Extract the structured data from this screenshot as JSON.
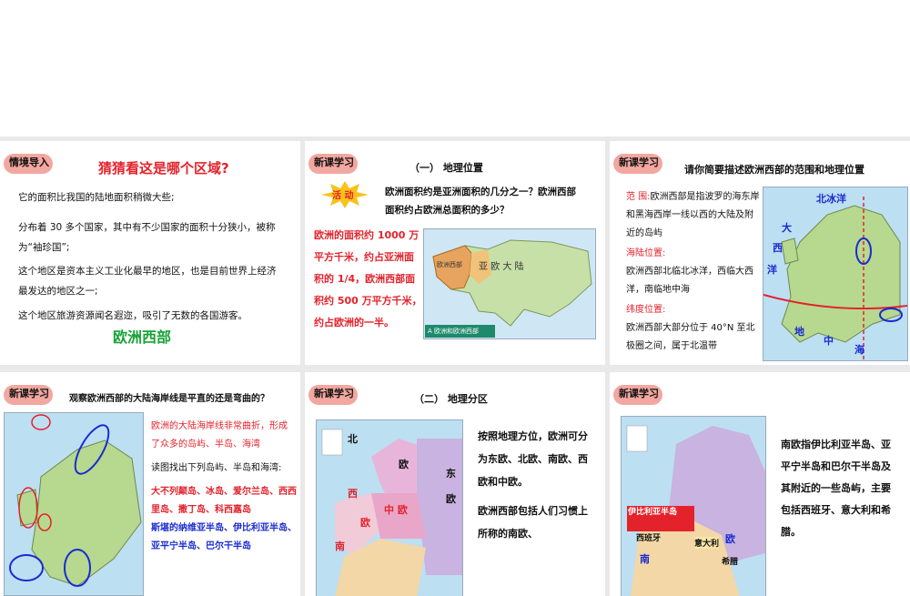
{
  "s1": {
    "tag": "情境导入",
    "title": "猜猜看这是哪个区域?",
    "p1": "它的面积比我国的陆地面积稍微大些;",
    "p2": "分布着 30 多个国家，其中有不少国家的面积十分狭小，被称为“袖珍国”;",
    "p3": "这个地区是资本主义工业化最早的地区，也是目前世界上经济最发达的地区之一;",
    "p4": "这个地区旅游资源闻名遐迩，吸引了无数的各国游客。",
    "answer": "欧洲西部"
  },
  "s2": {
    "tag": "新课学习",
    "heading": "（一） 地理位置",
    "activity": "活 动",
    "question": "欧洲面积约是亚洲面积的几分之一？欧洲西部面积约占欧洲总面积的多少？",
    "answer": "欧洲的面积约 1000 万平方千米，约占亚洲面积的 1/4，欧洲西部面积约 500 万平方千米，约占欧洲的一半。",
    "map_title": "亚 欧 大 陆",
    "map_west": "欧洲西部",
    "map_caption": "A 欧洲和欧洲西部"
  },
  "s3": {
    "tag": "新课学习",
    "heading": "请你简要描述欧洲西部的范围和地理位置",
    "range_label": "范 围:",
    "range_text": "欧洲西部是指波罗的海东岸和黑海西岸一线以西的大陆及附近的岛屿",
    "sea_label": "海陆位置:",
    "sea_text": "欧洲西部北临北冰洋，西临大西洋，南临地中海",
    "lat_label": "纬度位置:",
    "lat_text": "欧洲西部大部分位于 40°N 至北极圈之间，属于北温带",
    "map_labels": [
      "北冰洋",
      "大",
      "西",
      "洋",
      "地",
      "中",
      "海"
    ]
  },
  "s4": {
    "tag": "新课学习",
    "heading": "观察欧洲西部的大陆海岸线是平直的还是弯曲的？",
    "red_text": "欧洲的大陆海岸线非常曲折，形成了众多的岛屿、半岛、海湾",
    "instruction": "读图找出下列岛屿、半岛和海湾:",
    "islands": "大不列颠岛、冰岛、爱尔兰岛、西西里岛、撒丁岛、科西嘉岛",
    "peninsulas": "斯堪的纳维亚半岛、伊比利亚半岛、亚平宁半岛、巴尔干半岛"
  },
  "s5": {
    "tag": "新课学习",
    "heading": "（二） 地理分区",
    "text1": "按照地理方位，欧洲可分为东欧、北欧、南欧、西欧和中欧。",
    "text2": "欧洲西部包括人们习惯上所称的南欧、",
    "map_labels": [
      "北",
      "欧",
      "东",
      "欧",
      "西",
      "中 欧",
      "欧",
      "南"
    ]
  },
  "s6": {
    "tag": "新课学习",
    "text": "南欧指伊比利亚半岛、亚平宁半岛和巴尔干半岛及其附近的一些岛屿，主要包括西班牙、意大利和希腊。",
    "map_label1": "伊比利亚半岛",
    "map_label2": "西班牙",
    "map_label3": "意大利",
    "map_label4": "欧",
    "map_label5": "南",
    "map_label6": "希腊"
  },
  "colors": {
    "red": "#e4222b",
    "blue": "#1a2bd0",
    "tag": "#f2a7a0",
    "green": "#17a335"
  }
}
